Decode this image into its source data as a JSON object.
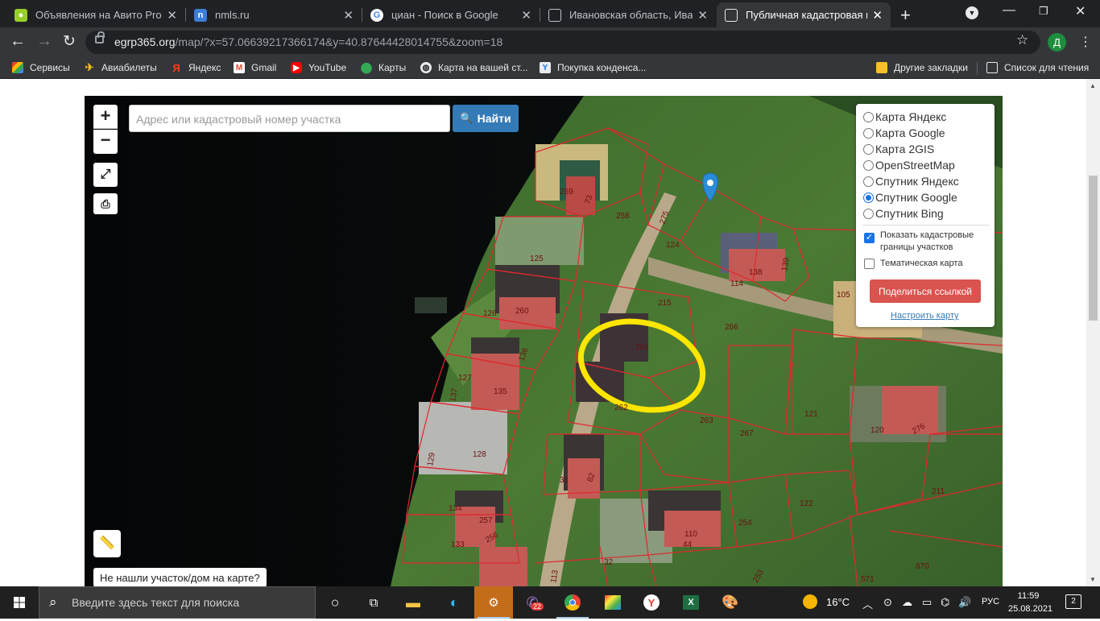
{
  "browser": {
    "tabs": [
      {
        "title": "Объявления на Авито Pro",
        "favicon": "avito-icon"
      },
      {
        "title": "nmls.ru",
        "favicon": "nmls-icon"
      },
      {
        "title": "циан - Поиск в Google",
        "favicon": "google-icon"
      },
      {
        "title": "Ивановская область, Ивано",
        "favicon": "document-icon"
      },
      {
        "title": "Публичная кадастровая кар",
        "favicon": "document-icon",
        "active": true
      }
    ],
    "url_host": "egrp365.org",
    "url_path": "/map/?x=57.06639217366174&y=40.87644428014755&zoom=18",
    "profile_initial": "Д"
  },
  "bookmarks": {
    "items": [
      {
        "label": "Сервисы",
        "icon": "apps-icon"
      },
      {
        "label": "Авиабилеты",
        "icon": "plane-icon"
      },
      {
        "label": "Яндекс",
        "icon": "yandex-icon"
      },
      {
        "label": "Gmail",
        "icon": "gmail-icon"
      },
      {
        "label": "YouTube",
        "icon": "youtube-icon"
      },
      {
        "label": "Карты",
        "icon": "maps-pin-icon"
      },
      {
        "label": "Карта на вашей ст...",
        "icon": "globe-icon"
      },
      {
        "label": "Покупка конденса...",
        "icon": "ad-icon"
      }
    ],
    "other": "Другие закладки",
    "reading_list": "Список для чтения"
  },
  "map": {
    "search_placeholder": "Адрес или кадастровый номер участка",
    "find_button": "Найти",
    "zoom_in": "+",
    "zoom_out": "−",
    "not_found": "Не нашли участок/дом на карте?",
    "layers": [
      {
        "label": "Карта Яндекс",
        "selected": false
      },
      {
        "label": "Карта Google",
        "selected": false
      },
      {
        "label": "Карта 2GIS",
        "selected": false
      },
      {
        "label": "OpenStreetMap",
        "selected": false
      },
      {
        "label": "Спутник Яндекс",
        "selected": false
      },
      {
        "label": "Спутник Google",
        "selected": true
      },
      {
        "label": "Спутник Bing",
        "selected": false
      }
    ],
    "show_borders_label": "Показать кадастровые границы участков",
    "show_borders_checked": true,
    "thematic_label": "Тематическая карта",
    "thematic_checked": false,
    "share_button": "Поделиться ссылкой",
    "setup_link": "Настроить карту",
    "parcel_labels": [
      "259",
      "73",
      "258",
      "275",
      "124",
      "125",
      "138",
      "139",
      "114",
      "260",
      "126",
      "215",
      "266",
      "105",
      "261",
      "136",
      "127",
      "135",
      "137",
      "262",
      "263",
      "267",
      "121",
      "120",
      "276",
      "128",
      "129",
      "31",
      "82",
      "134",
      "257",
      "256",
      "133",
      "110",
      "44",
      "254",
      "122",
      "211",
      "32",
      "113",
      "253",
      "870",
      "571"
    ],
    "highlight_color": "#ffe600",
    "border_color": "#e0282d"
  },
  "taskbar": {
    "search_placeholder": "Введите здесь текст для поиска",
    "viber_badge": "22",
    "weather": "16°C",
    "language": "РУС",
    "time": "11:59",
    "date": "25.08.2021",
    "notifications": "2"
  }
}
